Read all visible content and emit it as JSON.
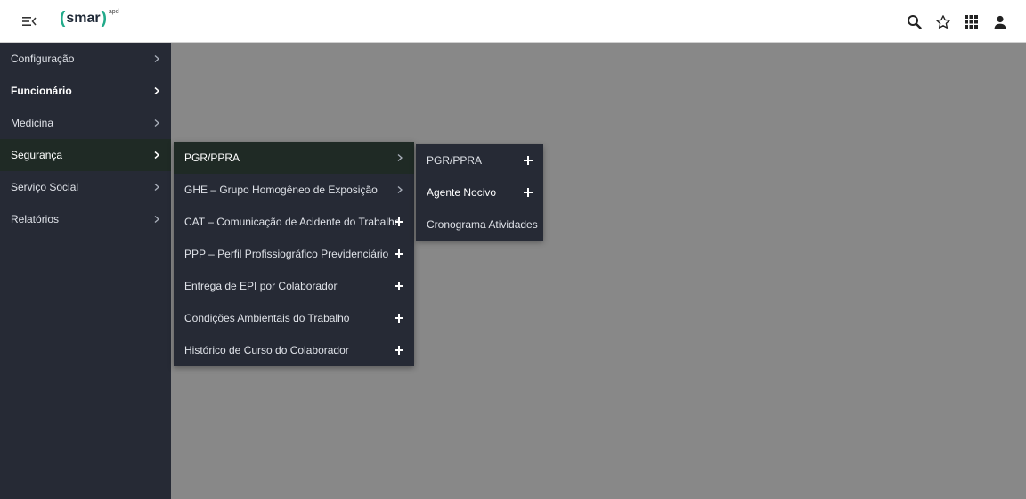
{
  "header": {
    "logo": {
      "paren_open": "(",
      "word": "smar",
      "paren_close": ")",
      "superscript": "apd"
    },
    "icons": [
      "menu-collapse-icon",
      "search-icon",
      "star-icon",
      "apps-grid-icon",
      "user-icon"
    ]
  },
  "sidebar": {
    "items": [
      {
        "label": "Configuração"
      },
      {
        "label": "Funcionário"
      },
      {
        "label": "Medicina"
      },
      {
        "label": "Segurança"
      },
      {
        "label": "Serviço Social"
      },
      {
        "label": "Relatórios"
      }
    ]
  },
  "submenu_seguranca": {
    "items": [
      {
        "label": "PGR/PPRA"
      },
      {
        "label": "GHE – Grupo Homogêneo de Exposição"
      },
      {
        "label": "CAT – Comunicação de Acidente do Trabalho"
      },
      {
        "label": "PPP – Perfil Profissiográfico Previdenciário"
      },
      {
        "label": "Entrega de EPI por Colaborador"
      },
      {
        "label": "Condições Ambientais do Trabalho"
      },
      {
        "label": "Histórico de Curso do Colaborador"
      }
    ]
  },
  "submenu_pgr": {
    "items": [
      {
        "label": "PGR/PPRA"
      },
      {
        "label": "Agente Nocivo"
      },
      {
        "label": "Cronograma Atividades"
      }
    ]
  },
  "colors": {
    "brand": "#22aa8a",
    "sidebar_bg": "#262a35",
    "content_bg": "#888888"
  }
}
